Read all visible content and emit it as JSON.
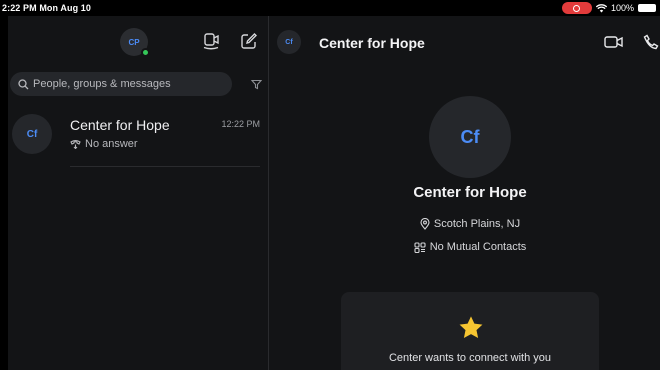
{
  "status_bar": {
    "time_date": "2:22 PM  Mon Aug 10",
    "battery": "100%"
  },
  "left": {
    "me_initials": "CP",
    "search": {
      "placeholder": "People, groups & messages"
    },
    "chat": {
      "initials": "Cf",
      "name": "Center for Hope",
      "time": "12:22 PM",
      "subtitle": "No answer"
    }
  },
  "conversation": {
    "header_initials": "Cf",
    "title": "Center for Hope",
    "profile": {
      "initials": "Cf",
      "name": "Center for Hope",
      "location": "Scotch Plains, NJ",
      "mutual": "No Mutual Contacts"
    },
    "card": {
      "text": "Center wants to connect with you"
    }
  },
  "colors": {
    "accent": "#4c8cf6",
    "presence": "#35c759",
    "recording": "#e23b3b",
    "star": "#f6c531"
  }
}
